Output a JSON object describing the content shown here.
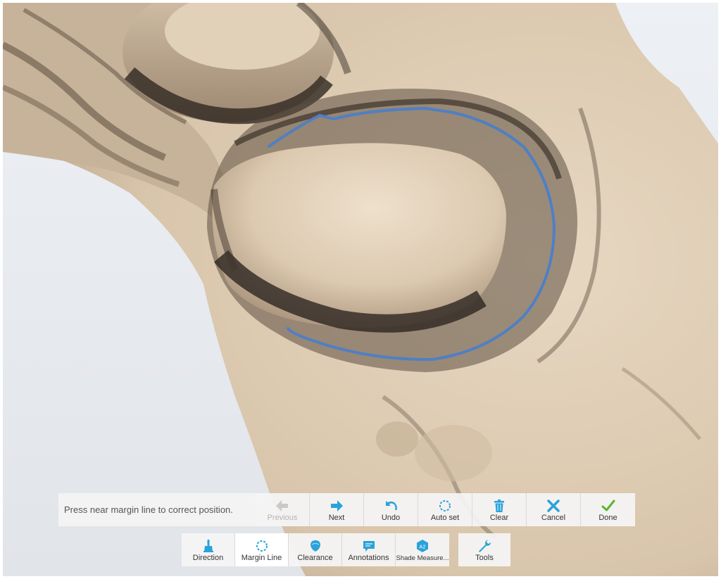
{
  "status_message": "Press near margin line to correct position.",
  "colors": {
    "accent": "#29a3da",
    "done_green": "#5cb531",
    "margin_line": "#4f7fc4",
    "model": "#e4d3bc",
    "shadow": "#3b342d"
  },
  "top_toolbar": {
    "previous": {
      "label": "Previous",
      "icon": "arrow-left-icon",
      "enabled": false
    },
    "next": {
      "label": "Next",
      "icon": "arrow-right-icon"
    },
    "undo": {
      "label": "Undo",
      "icon": "undo-icon"
    },
    "auto_set": {
      "label": "Auto set",
      "icon": "dotted-circle-icon"
    },
    "clear": {
      "label": "Clear",
      "icon": "trash-icon"
    },
    "cancel": {
      "label": "Cancel",
      "icon": "x-icon"
    },
    "done": {
      "label": "Done",
      "icon": "checkmark-icon"
    }
  },
  "bottom_toolbar": {
    "direction": {
      "label": "Direction",
      "icon": "brush-icon"
    },
    "margin_line": {
      "label": "Margin Line",
      "icon": "dotted-circle-icon",
      "selected": true
    },
    "clearance": {
      "label": "Clearance",
      "icon": "tooth-icon"
    },
    "annotations": {
      "label": "Annotations",
      "icon": "comment-icon"
    },
    "shade_measure": {
      "label": "Shade Measure...",
      "icon": "shade-badge-icon",
      "badge": "A2"
    },
    "tools": {
      "label": "Tools",
      "icon": "wrench-icon"
    }
  }
}
